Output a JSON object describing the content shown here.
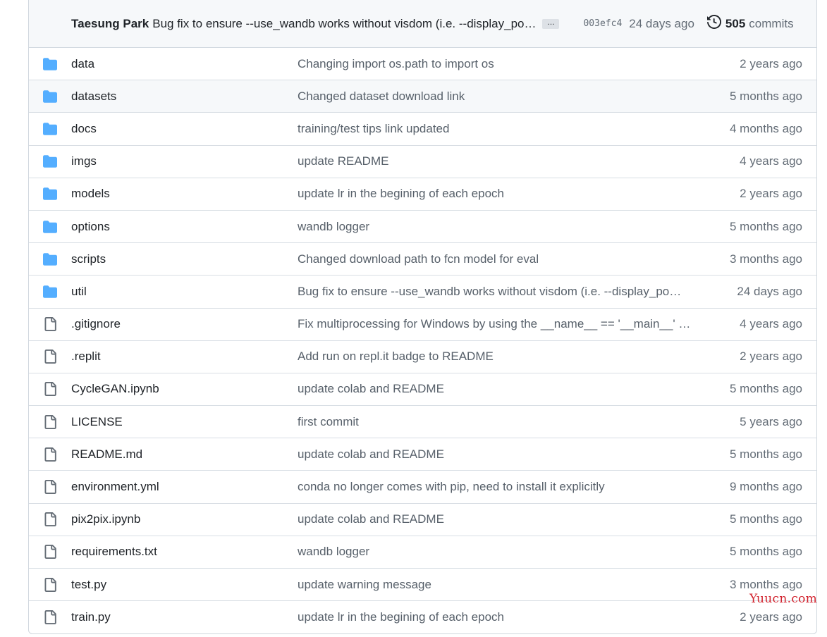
{
  "latest_commit": {
    "author": "Taesung Park",
    "message": "Bug fix to ensure --use_wandb works without visdom (i.e. --display_po…",
    "ellipsis": "…",
    "sha": "003efc4",
    "when": "24 days ago",
    "commits_count": "505",
    "commits_label": "commits"
  },
  "files": [
    {
      "type": "folder",
      "name": "data",
      "message": "Changing import os.path to import os",
      "age": "2 years ago"
    },
    {
      "type": "folder",
      "name": "datasets",
      "message": "Changed dataset download link",
      "age": "5 months ago"
    },
    {
      "type": "folder",
      "name": "docs",
      "message": "training/test tips link updated",
      "age": "4 months ago"
    },
    {
      "type": "folder",
      "name": "imgs",
      "message": "update README",
      "age": "4 years ago"
    },
    {
      "type": "folder",
      "name": "models",
      "message": "update lr in the begining of each epoch",
      "age": "2 years ago"
    },
    {
      "type": "folder",
      "name": "options",
      "message": "wandb logger",
      "age": "5 months ago"
    },
    {
      "type": "folder",
      "name": "scripts",
      "message": "Changed download path to fcn model for eval",
      "age": "3 months ago"
    },
    {
      "type": "folder",
      "name": "util",
      "message": "Bug fix to ensure --use_wandb works without visdom (i.e. --display_po…",
      "age": "24 days ago"
    },
    {
      "type": "file",
      "name": ".gitignore",
      "message": "Fix multiprocessing for Windows by using the __name__ == '__main__' i…",
      "age": "4 years ago"
    },
    {
      "type": "file",
      "name": ".replit",
      "message": "Add run on repl.it badge to README",
      "age": "2 years ago"
    },
    {
      "type": "file",
      "name": "CycleGAN.ipynb",
      "message": "update colab and README",
      "age": "5 months ago"
    },
    {
      "type": "file",
      "name": "LICENSE",
      "message": "first commit",
      "age": "5 years ago"
    },
    {
      "type": "file",
      "name": "README.md",
      "message": "update colab and README",
      "age": "5 months ago"
    },
    {
      "type": "file",
      "name": "environment.yml",
      "message": "conda no longer comes with pip, need to install it explicitly",
      "age": "9 months ago"
    },
    {
      "type": "file",
      "name": "pix2pix.ipynb",
      "message": "update colab and README",
      "age": "5 months ago"
    },
    {
      "type": "file",
      "name": "requirements.txt",
      "message": "wandb logger",
      "age": "5 months ago"
    },
    {
      "type": "file",
      "name": "test.py",
      "message": "update warning message",
      "age": "3 months ago"
    },
    {
      "type": "file",
      "name": "train.py",
      "message": "update lr in the begining of each epoch",
      "age": "2 years ago"
    }
  ],
  "highlighted_row": "datasets",
  "watermark": "Yuucn.com",
  "colors": {
    "folder_icon": "#54aeff",
    "file_icon": "#656d76",
    "header_bg": "#f6f8fa",
    "border": "#d0d7de",
    "muted_text": "#636c76",
    "watermark": "#d2222d"
  },
  "icons": {
    "folder": "folder-icon",
    "file": "file-icon",
    "history": "history-icon"
  }
}
